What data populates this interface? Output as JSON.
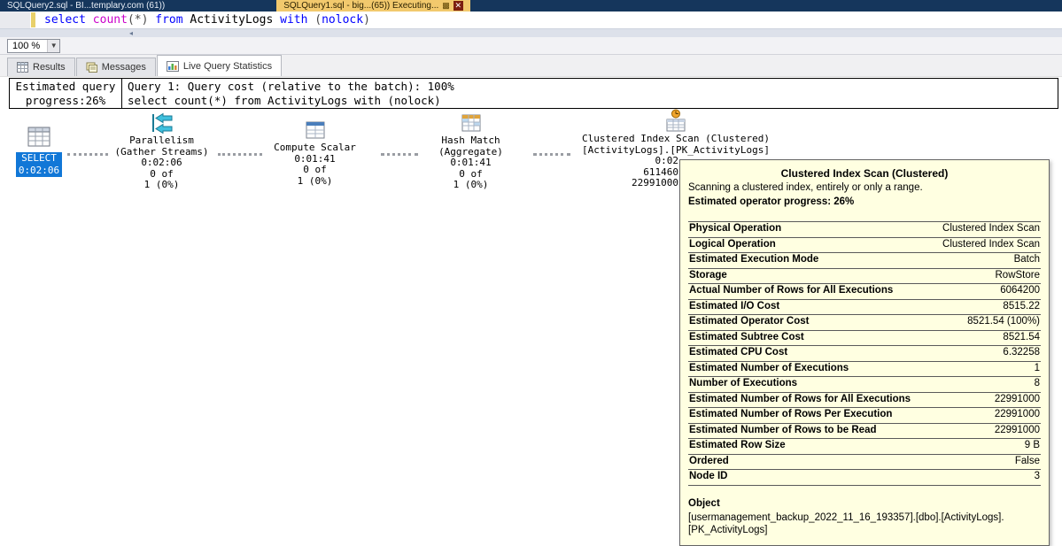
{
  "window": {
    "tabs": [
      {
        "label": "SQLQuery2.sql - BI...templary.com (61))",
        "active": false
      },
      {
        "label": "SQLQuery1.sql - big...(65)) Executing...",
        "active": true
      }
    ]
  },
  "editor": {
    "sql_tokens": [
      {
        "text": "select ",
        "color": "#0000ff"
      },
      {
        "text": "count",
        "color": "#ca00ca"
      },
      {
        "text": "(*) ",
        "color": "#4a4a4a"
      },
      {
        "text": "from ",
        "color": "#0000ff"
      },
      {
        "text": "ActivityLogs ",
        "color": "#000000"
      },
      {
        "text": "with ",
        "color": "#0000ff"
      },
      {
        "text": "(",
        "color": "#4a4a4a"
      },
      {
        "text": "nolock",
        "color": "#0000ff"
      },
      {
        "text": ")",
        "color": "#4a4a4a"
      }
    ]
  },
  "toolbar": {
    "zoom_value": "100 %"
  },
  "result_tabs": [
    {
      "label": "Results"
    },
    {
      "label": "Messages"
    },
    {
      "label": "Live Query Statistics"
    }
  ],
  "stats_header": {
    "progress_line1": "Estimated query",
    "progress_line2": "progress:26%",
    "query_cost": "Query 1: Query cost (relative to the batch): 100%",
    "query_text": "select count(*) from ActivityLogs with (nolock)"
  },
  "plan": {
    "nodes": [
      {
        "name": "SELECT",
        "time": "0:02:06"
      },
      {
        "title": "Parallelism",
        "subtitle": "(Gather Streams)",
        "time": "0:02:06",
        "progress": "0 of",
        "total": "1 (0%)"
      },
      {
        "title": "Compute Scalar",
        "time": "0:01:41",
        "progress": "0 of",
        "total": "1 (0%)"
      },
      {
        "title": "Hash Match",
        "subtitle": "(Aggregate)",
        "time": "0:01:41",
        "progress": "0 of",
        "total": "1 (0%)"
      },
      {
        "title": "Clustered Index Scan (Clustered)",
        "subtitle": "[ActivityLogs].[PK_ActivityLogs]",
        "time": "0:02",
        "progress": "611460",
        "total": "22991000"
      }
    ]
  },
  "tooltip": {
    "title": "Clustered Index Scan (Clustered)",
    "description": "Scanning a clustered index, entirely or only a range.",
    "progress": "Estimated operator progress: 26%",
    "rows": [
      {
        "label": "Physical Operation",
        "value": "Clustered Index Scan"
      },
      {
        "label": "Logical Operation",
        "value": "Clustered Index Scan"
      },
      {
        "label": "Estimated Execution Mode",
        "value": "Batch"
      },
      {
        "label": "Storage",
        "value": "RowStore"
      },
      {
        "label": "Actual Number of Rows for All Executions",
        "value": "6064200"
      },
      {
        "label": "Estimated I/O Cost",
        "value": "8515.22"
      },
      {
        "label": "Estimated Operator Cost",
        "value": "8521.54 (100%)"
      },
      {
        "label": "Estimated Subtree Cost",
        "value": "8521.54"
      },
      {
        "label": "Estimated CPU Cost",
        "value": "6.32258"
      },
      {
        "label": "Estimated Number of Executions",
        "value": "1"
      },
      {
        "label": "Number of Executions",
        "value": "8"
      },
      {
        "label": "Estimated Number of Rows for All Executions",
        "value": "22991000"
      },
      {
        "label": "Estimated Number of Rows Per Execution",
        "value": "22991000"
      },
      {
        "label": "Estimated Number of Rows to be Read",
        "value": "22991000"
      },
      {
        "label": "Estimated Row Size",
        "value": "9 B"
      },
      {
        "label": "Ordered",
        "value": "False"
      },
      {
        "label": "Node ID",
        "value": "3"
      }
    ],
    "object_label": "Object",
    "object_value": "[usermanagement_backup_2022_11_16_193357].[dbo].[ActivityLogs].[PK_ActivityLogs]"
  },
  "colors": {
    "accent_blue": "#1177d7",
    "active_tab_yellow": "#f2c96d",
    "tooltip_bg": "#ffffe1",
    "titlebar_navy": "#15365c"
  }
}
